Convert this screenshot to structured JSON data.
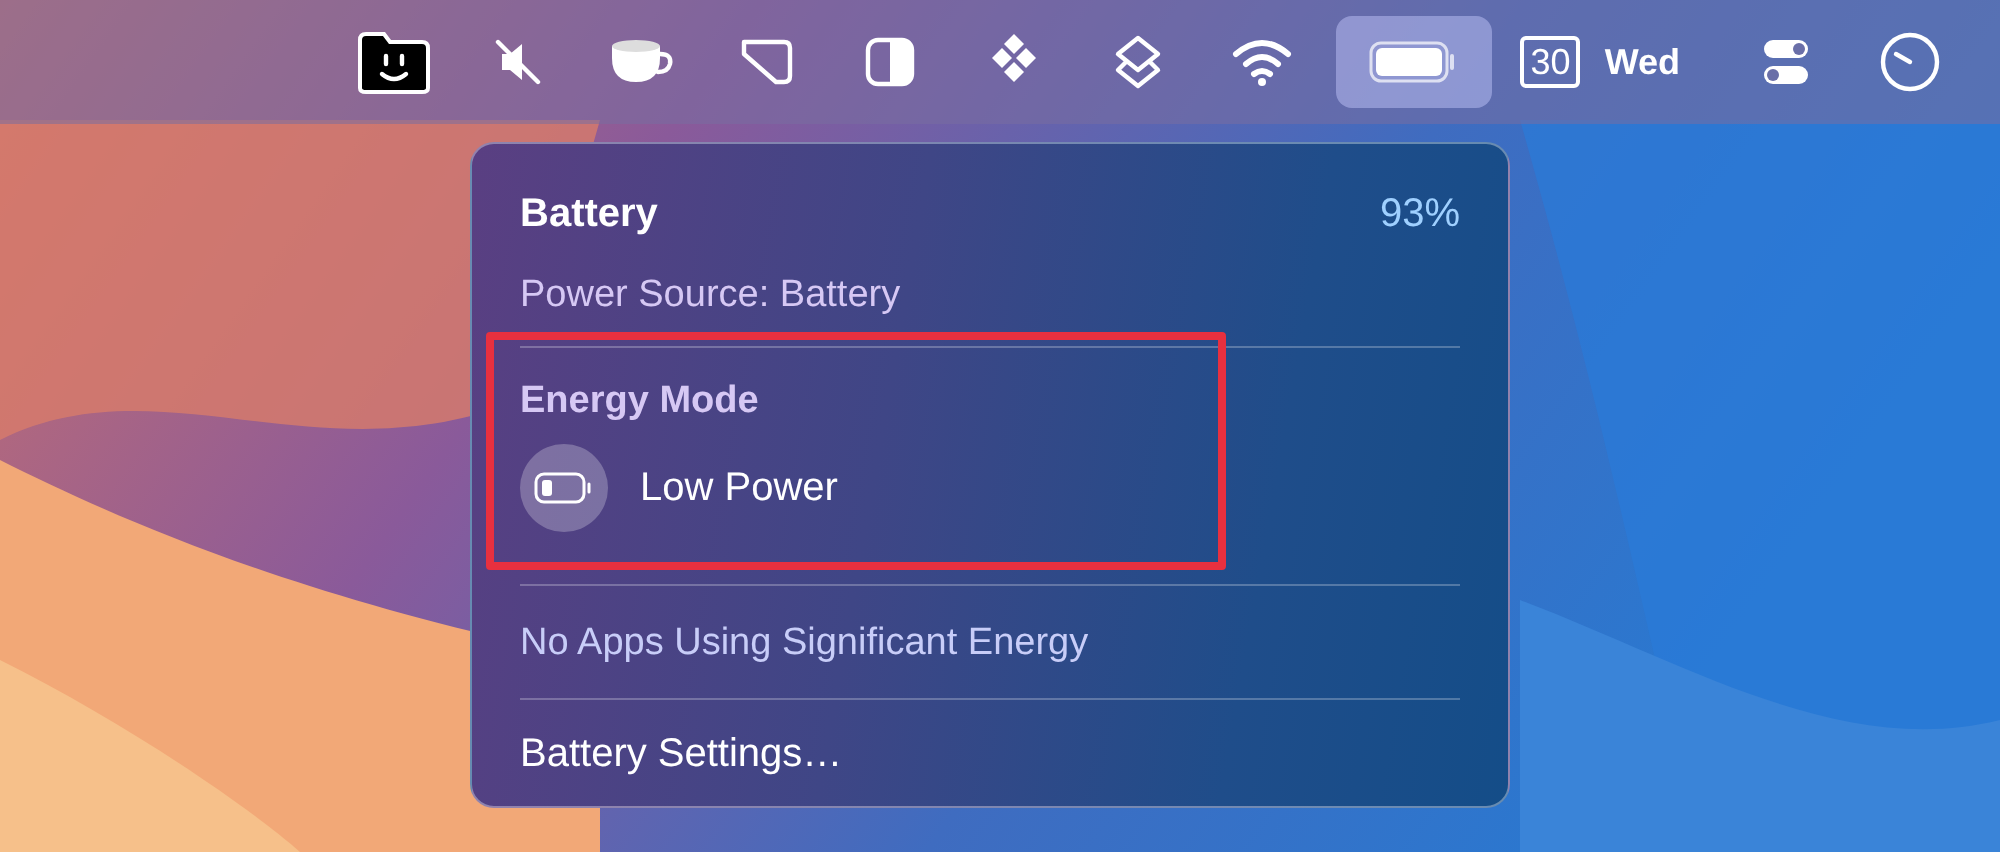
{
  "menu_bar": {
    "icons": [
      {
        "selected": false
      },
      {
        "selected": false
      },
      {
        "selected": false
      },
      {
        "selected": false
      },
      {
        "selected": false
      },
      {
        "selected": false
      },
      {
        "selected": false
      },
      {
        "selected": false
      },
      {
        "selected": true
      }
    ],
    "date_day": "30",
    "weekday": "Wed",
    "end_icons": [
      {
        "selected": false
      },
      {
        "selected": false
      }
    ]
  },
  "battery_menu": {
    "title": "Battery",
    "percent": "93%",
    "power_source": "Power Source: Battery",
    "energy_mode": {
      "heading": "Energy Mode",
      "highlighted": true,
      "option": {
        "label": "Low Power",
        "on": false
      }
    },
    "apps_note": "No Apps Using Significant Energy",
    "settings": "Battery Settings…"
  }
}
